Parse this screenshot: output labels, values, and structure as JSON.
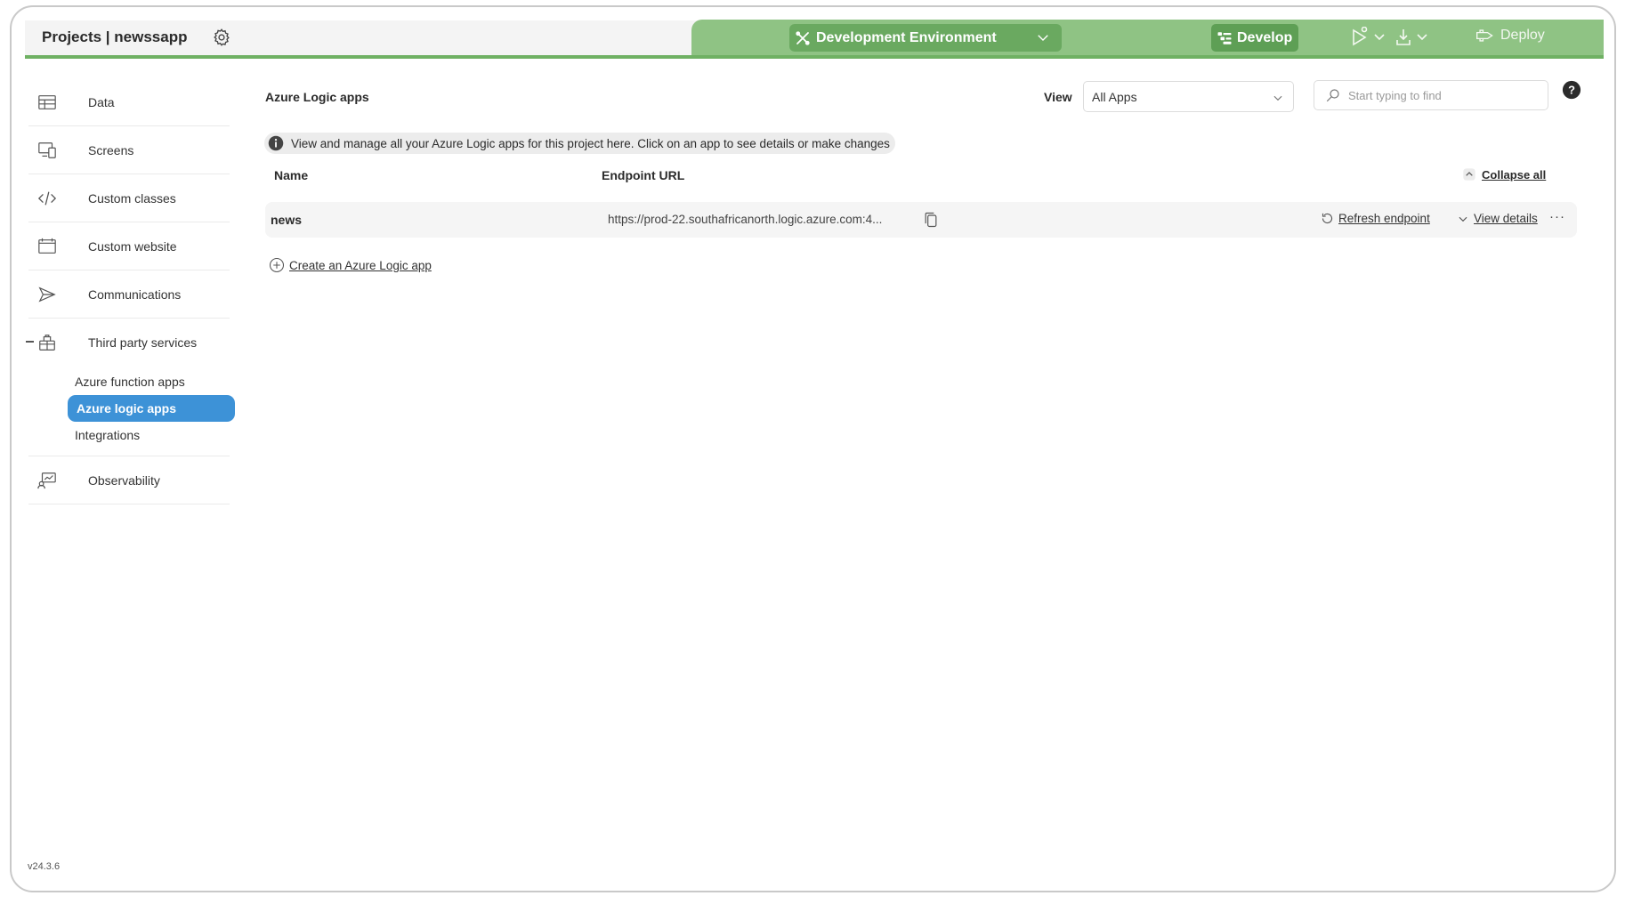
{
  "header": {
    "project_title": "Projects | newssapp",
    "environment": "Development Environment",
    "develop_label": "Develop",
    "deploy_label": "Deploy",
    "accent_color": "#8fc384"
  },
  "sidebar": {
    "items": [
      {
        "label": "Data",
        "icon": "table-icon"
      },
      {
        "label": "Screens",
        "icon": "screens-icon"
      },
      {
        "label": "Custom classes",
        "icon": "code-icon"
      },
      {
        "label": "Custom website",
        "icon": "browser-window-icon"
      },
      {
        "label": "Communications",
        "icon": "send-icon"
      },
      {
        "label": "Third party services",
        "icon": "gift-icon"
      }
    ],
    "third_party_sub": [
      {
        "label": "Azure function apps"
      },
      {
        "label": "Azure logic apps",
        "active": true
      },
      {
        "label": "Integrations"
      }
    ],
    "observability": {
      "label": "Observability",
      "icon": "monitor-chart-icon"
    },
    "version": "v24.3.6"
  },
  "main": {
    "title": "Azure Logic apps",
    "view_label": "View",
    "view_value": "All Apps",
    "search_placeholder": "Start typing to find",
    "info_text": "View and manage all your Azure Logic apps for this project here. Click on an app to see details or make changes",
    "columns": {
      "name": "Name",
      "endpoint": "Endpoint URL"
    },
    "collapse_all": "Collapse all",
    "apps": [
      {
        "name": "news",
        "endpoint": "https://prod-22.southafricanorth.logic.azure.com:4...",
        "refresh_label": "Refresh endpoint",
        "view_details_label": "View details"
      }
    ],
    "create_label": "Create an Azure Logic app"
  }
}
